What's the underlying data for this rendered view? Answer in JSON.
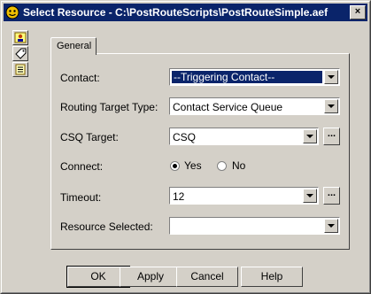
{
  "window": {
    "title": "Select Resource - C:\\PostRouteScripts\\PostRouteSimple.aef",
    "close_glyph": "×"
  },
  "sidebar": {
    "icons": [
      "user-icon",
      "tag-icon",
      "document-icon"
    ]
  },
  "tabs": [
    {
      "label": "General"
    }
  ],
  "form": {
    "contact": {
      "label": "Contact:",
      "value": "--Triggering Contact--"
    },
    "routing_target_type": {
      "label": "Routing Target Type:",
      "value": "Contact Service Queue"
    },
    "csq_target": {
      "label": "CSQ Target:",
      "value": "CSQ",
      "browse": "..."
    },
    "connect": {
      "label": "Connect:",
      "yes": "Yes",
      "no": "No",
      "selected": "Yes"
    },
    "timeout": {
      "label": "Timeout:",
      "value": "12",
      "browse": "..."
    },
    "resource_selected": {
      "label": "Resource Selected:",
      "value": ""
    }
  },
  "buttons": {
    "ok": "OK",
    "apply": "Apply",
    "cancel": "Cancel",
    "help": "Help"
  }
}
